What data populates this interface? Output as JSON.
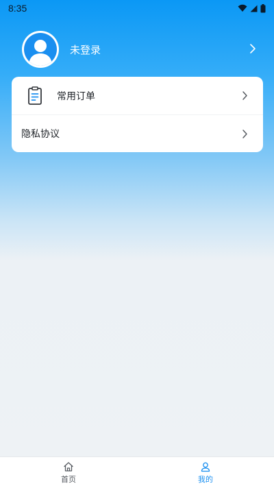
{
  "status_bar": {
    "time": "8:35",
    "icons": [
      "wifi-icon",
      "signal-icon",
      "battery-icon"
    ]
  },
  "profile": {
    "name": "未登录",
    "avatar_icon": "user-avatar-icon"
  },
  "menu": {
    "items": [
      {
        "label": "常用订单",
        "icon": "clipboard-icon"
      },
      {
        "label": "隐私协议"
      }
    ]
  },
  "tabbar": {
    "tabs": [
      {
        "label": "首页",
        "icon": "home-icon",
        "active": false
      },
      {
        "label": "我的",
        "icon": "user-icon",
        "active": true
      }
    ]
  },
  "colors": {
    "accent": "#1a8ff0",
    "header_top": "#0b98f5",
    "page_background": "#eef2f5"
  }
}
